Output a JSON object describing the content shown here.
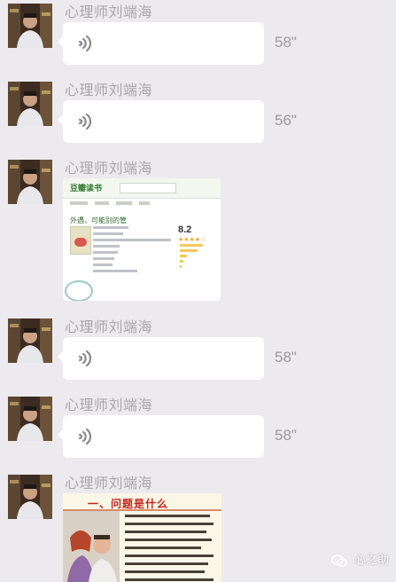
{
  "messages": [
    {
      "sender": "心理师刘端海",
      "type": "voice",
      "duration": "58\""
    },
    {
      "sender": "心理师刘端海",
      "type": "voice",
      "duration": "56\""
    },
    {
      "sender": "心理师刘端海",
      "type": "image",
      "image_kind": "douban-book-page",
      "page": {
        "logo": "豆瓣读书",
        "title": "外遇，可能别的管",
        "rating": "8.2"
      }
    },
    {
      "sender": "心理师刘端海",
      "type": "voice",
      "duration": "58\""
    },
    {
      "sender": "心理师刘端海",
      "type": "voice",
      "duration": "58\""
    },
    {
      "sender": "心理师刘端海",
      "type": "image",
      "image_kind": "presentation-slide",
      "slide": {
        "title": "一、问题是什么"
      }
    }
  ],
  "watermark": {
    "text": "心之助",
    "icon": "wechat-official-account-icon"
  },
  "colors": {
    "background": "#eceaee",
    "bubble": "#ffffff",
    "sender_text": "#a9a6ac",
    "slide_title": "#c5241c"
  }
}
